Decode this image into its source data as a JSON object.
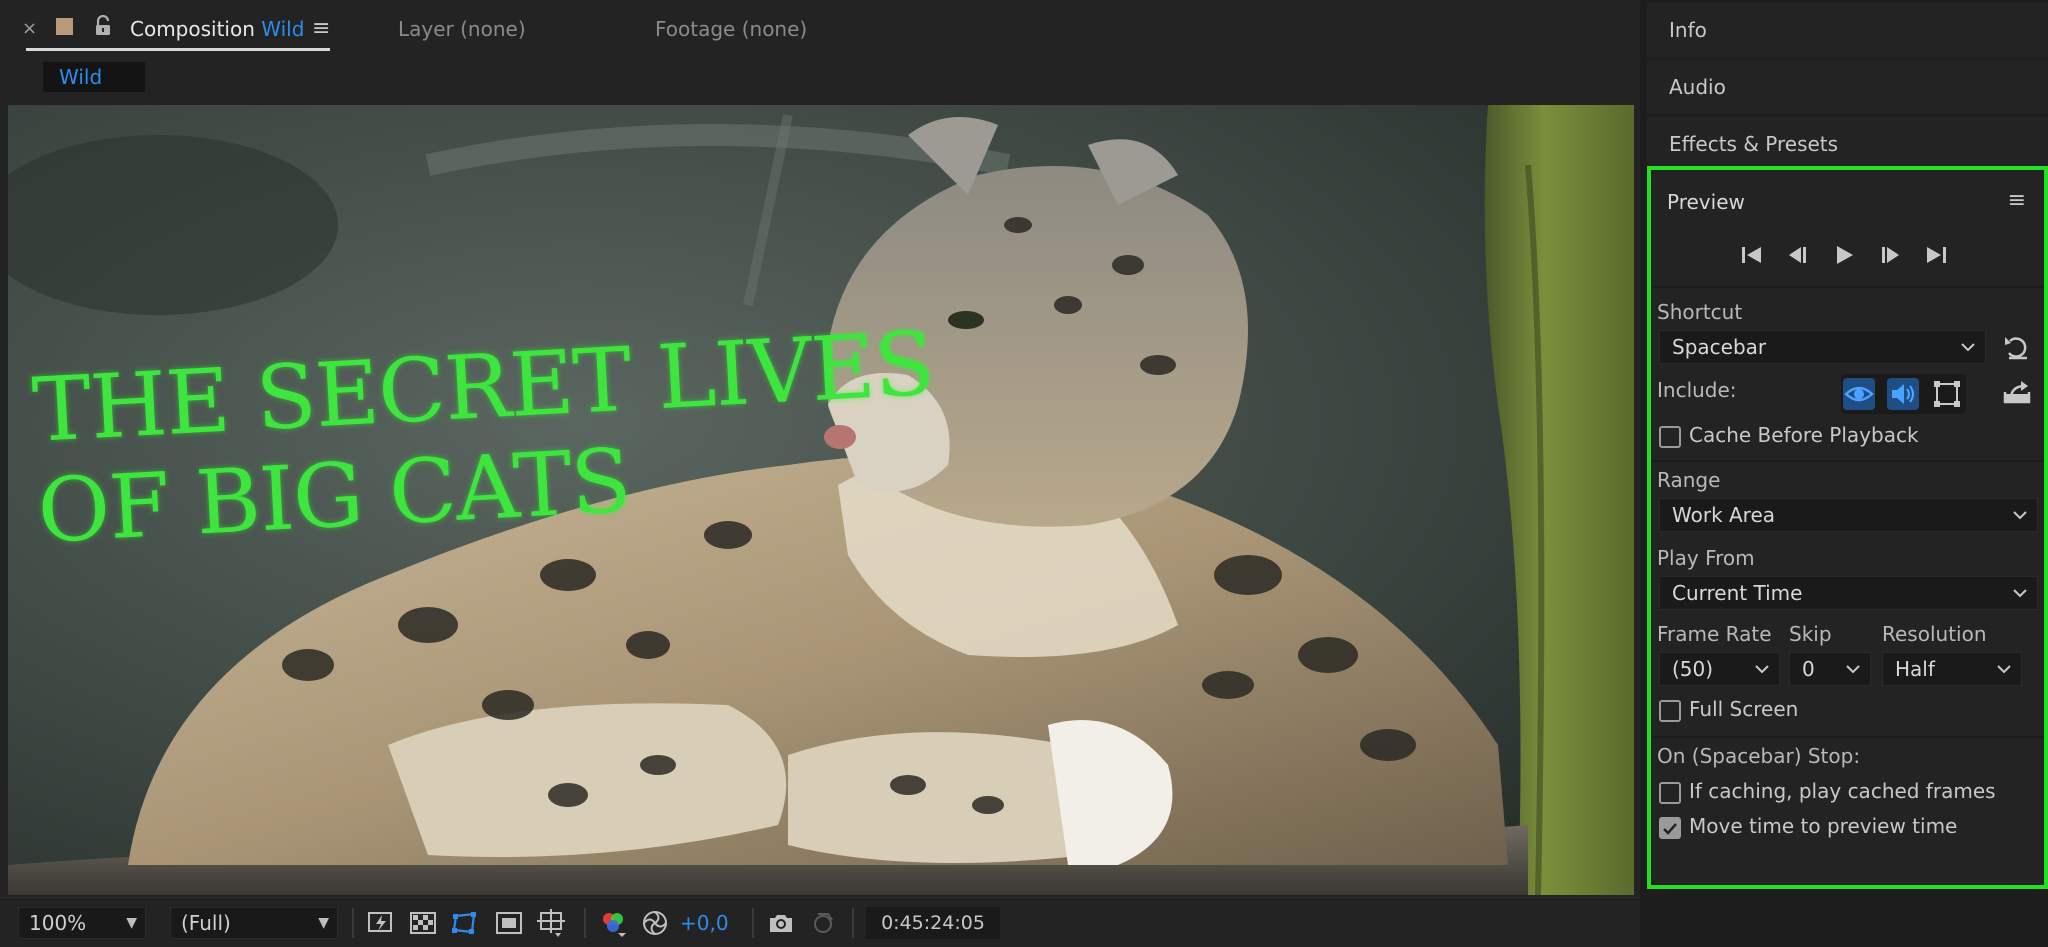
{
  "comp_panel": {
    "tabs": {
      "close_glyph": "×",
      "comp_prefix": "Composition",
      "comp_name": "Wild",
      "menu_glyph": "≡",
      "layer": "Layer (none)",
      "footage": "Footage (none)"
    },
    "chip": "Wild",
    "viewer_title": [
      "THE SECRET LIVES",
      "OF BIG CATS"
    ]
  },
  "toolbar": {
    "zoom": "100%",
    "resolution": "(Full)",
    "exposure": "+0,0",
    "timecode": "0:45:24:05"
  },
  "right_panel": {
    "info": "Info",
    "audio": "Audio",
    "effects": "Effects & Presets"
  },
  "preview": {
    "title": "Preview",
    "menu_glyph": "≡",
    "shortcut_label": "Shortcut",
    "shortcut_value": "Spacebar",
    "include_label": "Include:",
    "cache_before_playback": {
      "label": "Cache Before Playback",
      "checked": false
    },
    "range_label": "Range",
    "range_value": "Work Area",
    "play_from_label": "Play From",
    "play_from_value": "Current Time",
    "frame_rate_label": "Frame Rate",
    "frame_rate_value": "(50)",
    "skip_label": "Skip",
    "skip_value": "0",
    "resolution_label": "Resolution",
    "resolution_value": "Half",
    "full_screen": {
      "label": "Full Screen",
      "checked": false
    },
    "stop_label": "On (Spacebar) Stop:",
    "if_caching": {
      "label": "If caching, play cached frames",
      "checked": false
    },
    "move_time": {
      "label": "Move time to preview time",
      "checked": true
    }
  },
  "colors": {
    "accent_blue": "#2d8ceb",
    "highlight_green": "#22e022",
    "title_green": "#3fe53f"
  }
}
